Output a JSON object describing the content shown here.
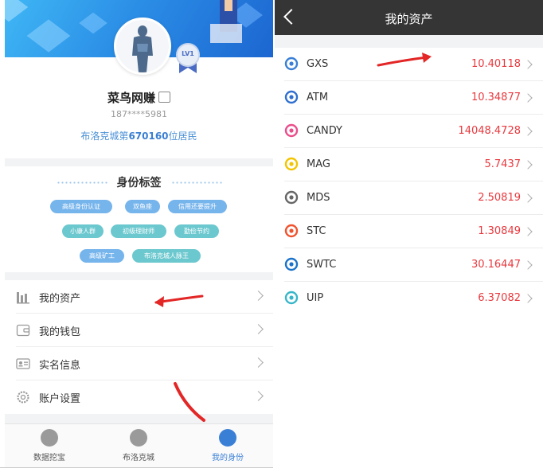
{
  "profile": {
    "nickname": "菜鸟网赚",
    "phone": "187****5981",
    "resident_prefix": "布洛克城第",
    "resident_number": "670160",
    "resident_suffix": "位居民",
    "level": "LV1"
  },
  "tags_section": {
    "title": "身份标签",
    "tags": [
      {
        "label": "高级身份认证",
        "color": "#76b4ec"
      },
      {
        "label": "双鱼座",
        "color": "#76b4ec"
      },
      {
        "label": "信用还要提升",
        "color": "#76b4ec"
      },
      {
        "label": "小康人群",
        "color": "#6cc8cf"
      },
      {
        "label": "初级理财师",
        "color": "#6cc8cf"
      },
      {
        "label": "勤俭节约",
        "color": "#6cc8cf"
      },
      {
        "label": "高级矿工",
        "color": "#76b4ec"
      },
      {
        "label": "布洛克城人脉王",
        "color": "#6cc8cf"
      }
    ]
  },
  "menu": [
    {
      "label": "我的资产",
      "icon": "bar-chart-icon"
    },
    {
      "label": "我的钱包",
      "icon": "wallet-icon"
    },
    {
      "label": "实名信息",
      "icon": "id-card-icon"
    },
    {
      "label": "账户设置",
      "icon": "gear-icon"
    }
  ],
  "tabbar": [
    {
      "label": "数据挖宝",
      "icon": "shovel-icon",
      "active": false
    },
    {
      "label": "布洛克城",
      "icon": "city-icon",
      "active": false
    },
    {
      "label": "我的身份",
      "icon": "identity-icon",
      "active": true
    }
  ],
  "assets_page": {
    "title": "我的资产",
    "assets": [
      {
        "name": "GXS",
        "value": "10.40118",
        "icon": "gxs-icon",
        "color": "#3a7fd6"
      },
      {
        "name": "ATM",
        "value": "10.34877",
        "icon": "atm-icon",
        "color": "#2e6fd0"
      },
      {
        "name": "CANDY",
        "value": "14048.4728",
        "icon": "candy-icon",
        "color": "#e94e8b"
      },
      {
        "name": "MAG",
        "value": "5.7437",
        "icon": "mag-icon",
        "color": "#f2c500"
      },
      {
        "name": "MDS",
        "value": "2.50819",
        "icon": "mds-icon",
        "color": "#666666"
      },
      {
        "name": "STC",
        "value": "1.30849",
        "icon": "stc-icon",
        "color": "#f0522d"
      },
      {
        "name": "SWTC",
        "value": "30.16447",
        "icon": "swtc-icon",
        "color": "#1a73c9"
      },
      {
        "name": "UIP",
        "value": "6.37082",
        "icon": "uip-icon",
        "color": "#38b6c9"
      }
    ]
  },
  "colors": {
    "accent": "#3a7fd6",
    "value_red": "#e8383d",
    "annotation_red": "#e32626"
  }
}
